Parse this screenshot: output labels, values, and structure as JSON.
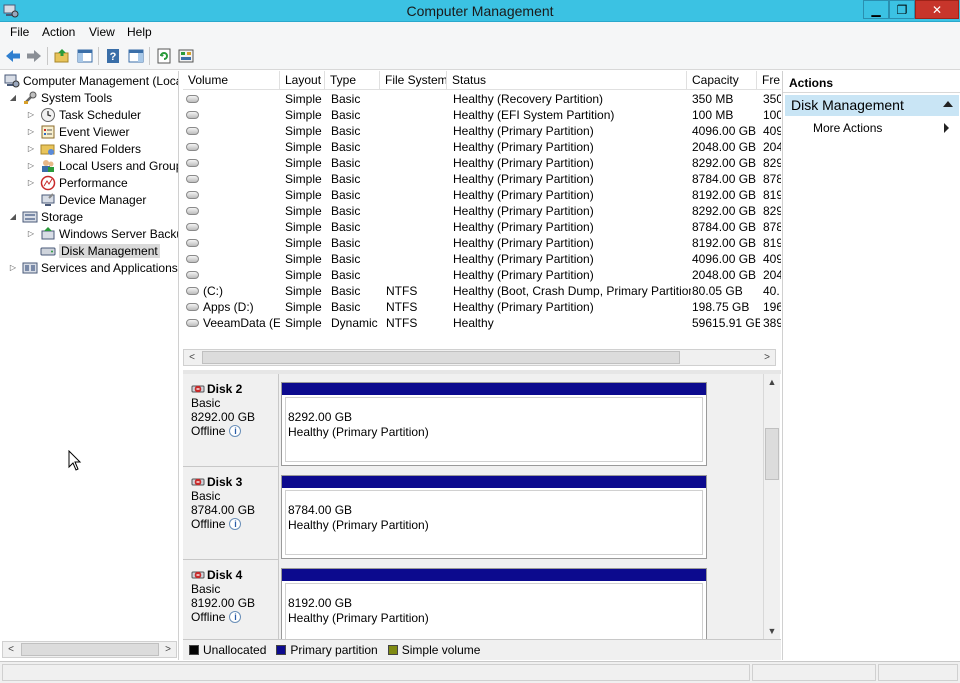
{
  "window": {
    "title": "Computer Management"
  },
  "menu": [
    "File",
    "Action",
    "View",
    "Help"
  ],
  "tree": {
    "items": [
      {
        "label": "Computer Management (Local",
        "level": 0,
        "expand": "",
        "icon": "computer-management-icon"
      },
      {
        "label": "System Tools",
        "level": 1,
        "expand": "◢",
        "icon": "system-tools-icon"
      },
      {
        "label": "Task Scheduler",
        "level": 2,
        "expand": "▷",
        "icon": "task-scheduler-icon"
      },
      {
        "label": "Event Viewer",
        "level": 2,
        "expand": "▷",
        "icon": "event-viewer-icon"
      },
      {
        "label": "Shared Folders",
        "level": 2,
        "expand": "▷",
        "icon": "shared-folders-icon"
      },
      {
        "label": "Local Users and Groups",
        "level": 2,
        "expand": "▷",
        "icon": "local-users-icon"
      },
      {
        "label": "Performance",
        "level": 2,
        "expand": "▷",
        "icon": "performance-icon"
      },
      {
        "label": "Device Manager",
        "level": 2,
        "expand": "",
        "icon": "device-manager-icon"
      },
      {
        "label": "Storage",
        "level": 1,
        "expand": "◢",
        "icon": "storage-icon"
      },
      {
        "label": "Windows Server Backup",
        "level": 2,
        "expand": "▷",
        "icon": "windows-server-backup-icon"
      },
      {
        "label": "Disk Management",
        "level": 2,
        "expand": "",
        "icon": "disk-management-icon",
        "selected": true
      },
      {
        "label": "Services and Applications",
        "level": 1,
        "expand": "▷",
        "icon": "services-icon"
      }
    ]
  },
  "volumes": {
    "columns": [
      "Volume",
      "Layout",
      "Type",
      "File System",
      "Status",
      "Capacity",
      "Fre"
    ],
    "rows": [
      {
        "volume": "",
        "layout": "Simple",
        "type": "Basic",
        "fs": "",
        "status": "Healthy (Recovery Partition)",
        "capacity": "350 MB",
        "free": "350"
      },
      {
        "volume": "",
        "layout": "Simple",
        "type": "Basic",
        "fs": "",
        "status": "Healthy (EFI System Partition)",
        "capacity": "100 MB",
        "free": "100"
      },
      {
        "volume": "",
        "layout": "Simple",
        "type": "Basic",
        "fs": "",
        "status": "Healthy (Primary Partition)",
        "capacity": "4096.00 GB",
        "free": "409"
      },
      {
        "volume": "",
        "layout": "Simple",
        "type": "Basic",
        "fs": "",
        "status": "Healthy (Primary Partition)",
        "capacity": "2048.00 GB",
        "free": "204"
      },
      {
        "volume": "",
        "layout": "Simple",
        "type": "Basic",
        "fs": "",
        "status": "Healthy (Primary Partition)",
        "capacity": "8292.00 GB",
        "free": "829"
      },
      {
        "volume": "",
        "layout": "Simple",
        "type": "Basic",
        "fs": "",
        "status": "Healthy (Primary Partition)",
        "capacity": "8784.00 GB",
        "free": "878"
      },
      {
        "volume": "",
        "layout": "Simple",
        "type": "Basic",
        "fs": "",
        "status": "Healthy (Primary Partition)",
        "capacity": "8192.00 GB",
        "free": "819"
      },
      {
        "volume": "",
        "layout": "Simple",
        "type": "Basic",
        "fs": "",
        "status": "Healthy (Primary Partition)",
        "capacity": "8292.00 GB",
        "free": "829"
      },
      {
        "volume": "",
        "layout": "Simple",
        "type": "Basic",
        "fs": "",
        "status": "Healthy (Primary Partition)",
        "capacity": "8784.00 GB",
        "free": "878"
      },
      {
        "volume": "",
        "layout": "Simple",
        "type": "Basic",
        "fs": "",
        "status": "Healthy (Primary Partition)",
        "capacity": "8192.00 GB",
        "free": "819"
      },
      {
        "volume": "",
        "layout": "Simple",
        "type": "Basic",
        "fs": "",
        "status": "Healthy (Primary Partition)",
        "capacity": "4096.00 GB",
        "free": "409"
      },
      {
        "volume": "",
        "layout": "Simple",
        "type": "Basic",
        "fs": "",
        "status": "Healthy (Primary Partition)",
        "capacity": "2048.00 GB",
        "free": "204"
      },
      {
        "volume": "(C:)",
        "layout": "Simple",
        "type": "Basic",
        "fs": "NTFS",
        "status": "Healthy (Boot, Crash Dump, Primary Partition)",
        "capacity": "80.05 GB",
        "free": "40."
      },
      {
        "volume": "Apps (D:)",
        "layout": "Simple",
        "type": "Basic",
        "fs": "NTFS",
        "status": "Healthy (Primary Partition)",
        "capacity": "198.75 GB",
        "free": "196"
      },
      {
        "volume": "VeeamData (E:)",
        "layout": "Simple",
        "type": "Dynamic",
        "fs": "NTFS",
        "status": "Healthy",
        "capacity": "59615.91 GB",
        "free": "389"
      }
    ]
  },
  "disks": [
    {
      "name": "Disk 2",
      "type": "Basic",
      "size": "8292.00 GB",
      "state": "Offline",
      "part_size": "8292.00 GB",
      "part_status": "Healthy (Primary Partition)"
    },
    {
      "name": "Disk 3",
      "type": "Basic",
      "size": "8784.00 GB",
      "state": "Offline",
      "part_size": "8784.00 GB",
      "part_status": "Healthy (Primary Partition)"
    },
    {
      "name": "Disk 4",
      "type": "Basic",
      "size": "8192.00 GB",
      "state": "Offline",
      "part_size": "8192.00 GB",
      "part_status": "Healthy (Primary Partition)"
    }
  ],
  "legend": [
    {
      "label": "Unallocated",
      "color": "#000000"
    },
    {
      "label": "Primary partition",
      "color": "#0c0a8e"
    },
    {
      "label": "Simple volume",
      "color": "#7f8a12"
    }
  ],
  "actions": {
    "header": "Actions",
    "section": "Disk Management",
    "more": "More Actions"
  },
  "colors": {
    "titlebar": "#3bc2e3",
    "primary_partition": "#0c0a8e",
    "close_button": "#c7352b",
    "actions_section": "#c9e5f5"
  }
}
